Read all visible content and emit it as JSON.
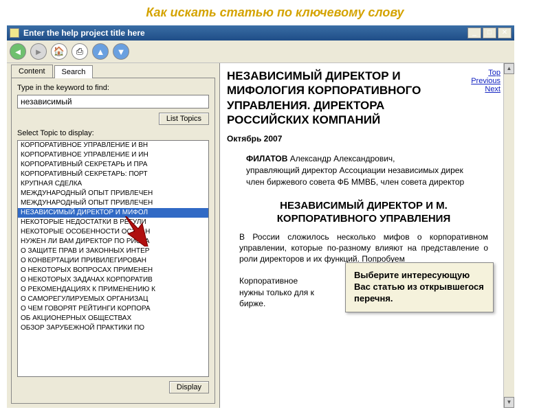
{
  "page_heading": "Как искать статью по ключевому слову",
  "window": {
    "title": "Enter the help project title here"
  },
  "sidebar": {
    "tabs": {
      "content": "Content",
      "search": "Search"
    },
    "keyword_label": "Type in the keyword to find:",
    "keyword_value": "независимый",
    "list_topics_btn": "List Topics",
    "select_label": "Select Topic to display:",
    "display_btn": "Display",
    "topics": [
      "КОРПОРАТИВНОЕ УПРАВЛЕНИЕ И ВН",
      "КОРПОРАТИВНОЕ УПРАВЛЕНИЕ И ИН",
      "КОРПОРАТИВНЫЙ СЕКРЕТАРЬ И ПРА",
      "КОРПОРАТИВНЫЙ СЕКРЕТАРЬ: ПОРТ",
      "КРУПНАЯ СДЕЛКА",
      "МЕЖДУНАРОДНЫЙ ОПЫТ ПРИВЛЕЧЕН",
      "МЕЖДУНАРОДНЫЙ ОПЫТ ПРИВЛЕЧЕН",
      "НЕЗАВИСИМЫЙ ДИРЕКТОР И МИФОЛ",
      "НЕКОТОРЫЕ НЕДОСТАТКИ В РЕГУЛИ",
      "НЕКОТОРЫЕ ОСОБЕННОСТИ ОСЗДАН",
      "НУЖЕН ЛИ ВАМ ДИРЕКТОР ПО РИСКА",
      "О ЗАЩИТЕ ПРАВ И ЗАКОННЫХ ИНТЕР",
      "О КОНВЕРТАЦИИ ПРИВИЛЕГИРОВАН",
      "О НЕКОТОРЫХ ВОПРОСАХ ПРИМЕНЕН",
      "О НЕКОТОРЫХ ЗАДАЧАХ КОРПОРАТИВ",
      "О РЕКОМЕНДАЦИЯХ К ПРИМЕНЕНИЮ К",
      "О САМОРЕГУЛИРУЕМЫХ ОРГАНИЗАЦ",
      "О ЧЕМ ГОВОРЯТ РЕЙТИНГИ КОРПОРА",
      "ОБ АКЦИОНЕРНЫХ ОБЩЕСТВАХ",
      "ОБЗОР ЗАРУБЕЖНОЙ ПРАКТИКИ ПО"
    ],
    "selected_index": 7
  },
  "document": {
    "title": "НЕЗАВИСИМЫЙ ДИРЕКТОР И МИФОЛОГИЯ КОРПОРАТИВНОГО УПРАВЛЕНИЯ. ДИРЕКТОРА РОССИЙСКИХ КОМПАНИЙ",
    "nav": {
      "top": "Top",
      "prev": "Previous",
      "next": "Next"
    },
    "date": "Октябрь 2007",
    "author_name": "ФИЛАТОВ",
    "author_first": " Александр Александрович,",
    "author_lines": [
      "управляющий директор Ассоциации независимых дирек",
      "член биржевого совета ФБ ММВБ, член совета директор"
    ],
    "section_title": "НЕЗАВИСИМЫЙ ДИРЕКТОР И М. КОРПОРАТИВНОГО УПРАВЛЕНИЯ",
    "para": "В России сложилось несколько мифов о корпоративном управлении, которые по-разному влияют на представление о роли директоров и их функций. Попробуем",
    "para2_a": "Корпоративное",
    "para2_b": "нужны только для к",
    "para2_c": "бирже."
  },
  "callout": "Выберите интересующую Вас статью из открывшегося перечня."
}
